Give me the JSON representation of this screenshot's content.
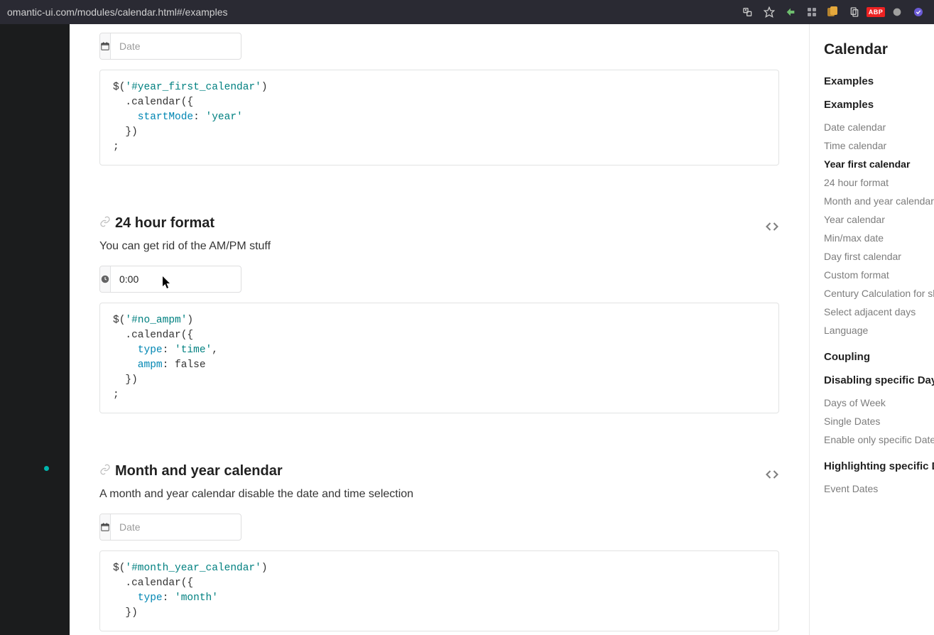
{
  "browser": {
    "url": "omantic-ui.com/modules/calendar.html#/examples"
  },
  "rail": {
    "title": "Calendar",
    "groups": [
      {
        "header": "Examples",
        "items": []
      },
      {
        "header": "Examples",
        "items": [
          {
            "label": "Date calendar",
            "active": false
          },
          {
            "label": "Time calendar",
            "active": false
          },
          {
            "label": "Year first calendar",
            "active": true
          },
          {
            "label": "24 hour format",
            "active": false
          },
          {
            "label": "Month and year calendar",
            "active": false
          },
          {
            "label": "Year calendar",
            "active": false
          },
          {
            "label": "Min/max date",
            "active": false
          },
          {
            "label": "Day first calendar",
            "active": false
          },
          {
            "label": "Custom format",
            "active": false
          },
          {
            "label": "Century Calculation for shorthand years",
            "active": false
          },
          {
            "label": "Select adjacent days",
            "active": false
          },
          {
            "label": "Language",
            "active": false
          }
        ]
      },
      {
        "header": "Coupling",
        "items": []
      },
      {
        "header": "Disabling specific Days",
        "items": [
          {
            "label": "Days of Week",
            "active": false
          },
          {
            "label": "Single Dates",
            "active": false
          },
          {
            "label": "Enable only specific Dates",
            "active": false
          }
        ]
      },
      {
        "header": "Highlighting specific Dates",
        "items": [
          {
            "label": "Event Dates",
            "active": false
          }
        ]
      }
    ]
  },
  "sections": {
    "year_first": {
      "input_placeholder": "Date",
      "code_lines": [
        {
          "t": "$(",
          "a": ""
        },
        {
          "t": "'#year_first_calendar'",
          "a": "sel"
        },
        {
          "t": ")",
          "a": ""
        },
        {
          "nl": true
        },
        {
          "t": "  .calendar({",
          "a": ""
        },
        {
          "nl": true
        },
        {
          "t": "    startMode",
          "a": "key"
        },
        {
          "t": ": ",
          "a": ""
        },
        {
          "t": "'year'",
          "a": "str"
        },
        {
          "nl": true
        },
        {
          "t": "  })",
          "a": ""
        },
        {
          "nl": true
        },
        {
          "t": ";",
          "a": ""
        }
      ]
    },
    "no_ampm": {
      "title": "24 hour format",
      "desc": "You can get rid of the AM/PM stuff",
      "input_value": "0:00",
      "code_lines": [
        {
          "t": "$(",
          "a": ""
        },
        {
          "t": "'#no_ampm'",
          "a": "sel"
        },
        {
          "t": ")",
          "a": ""
        },
        {
          "nl": true
        },
        {
          "t": "  .calendar({",
          "a": ""
        },
        {
          "nl": true
        },
        {
          "t": "    ",
          "a": ""
        },
        {
          "t": "type",
          "a": "key"
        },
        {
          "t": ": ",
          "a": ""
        },
        {
          "t": "'time'",
          "a": "str"
        },
        {
          "t": ",",
          "a": ""
        },
        {
          "nl": true
        },
        {
          "t": "    ampm",
          "a": "key"
        },
        {
          "t": ": false",
          "a": ""
        },
        {
          "nl": true
        },
        {
          "t": "  })",
          "a": ""
        },
        {
          "nl": true
        },
        {
          "t": ";",
          "a": ""
        }
      ]
    },
    "month_year": {
      "title": "Month and year calendar",
      "desc": "A month and year calendar disable the date and time selection",
      "input_placeholder": "Date",
      "code_lines": [
        {
          "t": "$(",
          "a": ""
        },
        {
          "t": "'#month_year_calendar'",
          "a": "sel"
        },
        {
          "t": ")",
          "a": ""
        },
        {
          "nl": true
        },
        {
          "t": "  .calendar({",
          "a": ""
        },
        {
          "nl": true
        },
        {
          "t": "    ",
          "a": ""
        },
        {
          "t": "type",
          "a": "key"
        },
        {
          "t": ": ",
          "a": ""
        },
        {
          "t": "'month'",
          "a": "str"
        },
        {
          "nl": true
        },
        {
          "t": "  })",
          "a": ""
        }
      ]
    }
  }
}
